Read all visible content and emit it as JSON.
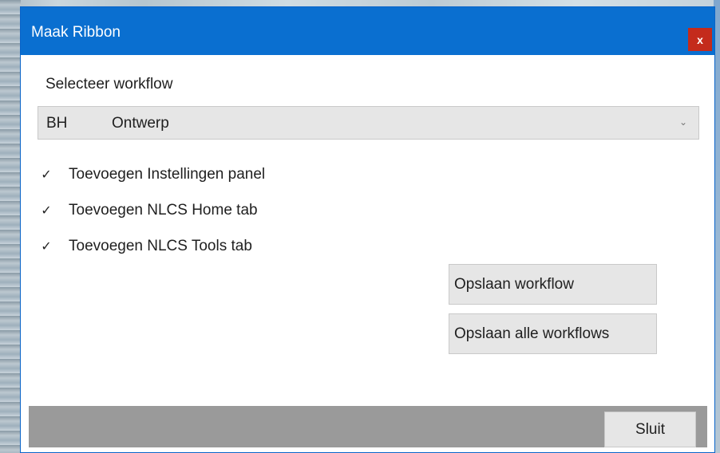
{
  "window": {
    "title": "Maak Ribbon",
    "close_label": "x"
  },
  "workflow": {
    "label": "Selecteer workflow",
    "selected_code": "BH",
    "selected_name": "Ontwerp",
    "chevron": "⌄"
  },
  "options": [
    {
      "label": "Toevoegen Instellingen panel",
      "checked": true,
      "mark": "✓"
    },
    {
      "label": "Toevoegen NLCS Home tab",
      "checked": true,
      "mark": "✓"
    },
    {
      "label": "Toevoegen NLCS Tools tab",
      "checked": true,
      "mark": "✓"
    }
  ],
  "buttons": {
    "save_workflow": "Opslaan workflow",
    "save_all": "Opslaan alle workflows",
    "close": "Sluit"
  },
  "colors": {
    "titlebar": "#0a6fd0",
    "close_button": "#c42b1c",
    "footer": "#9a9a9a"
  }
}
